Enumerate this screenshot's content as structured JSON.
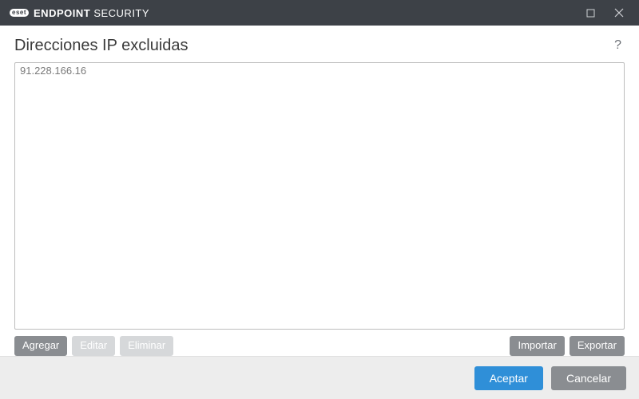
{
  "titlebar": {
    "brand_prefix": "eset",
    "brand_bold": "ENDPOINT",
    "brand_light": "SECURITY"
  },
  "page": {
    "title": "Direcciones IP excluidas"
  },
  "list": {
    "items": [
      "91.228.166.16"
    ]
  },
  "toolbar": {
    "add": "Agregar",
    "edit": "Editar",
    "delete": "Eliminar",
    "import": "Importar",
    "export": "Exportar"
  },
  "footer": {
    "accept": "Aceptar",
    "cancel": "Cancelar"
  }
}
